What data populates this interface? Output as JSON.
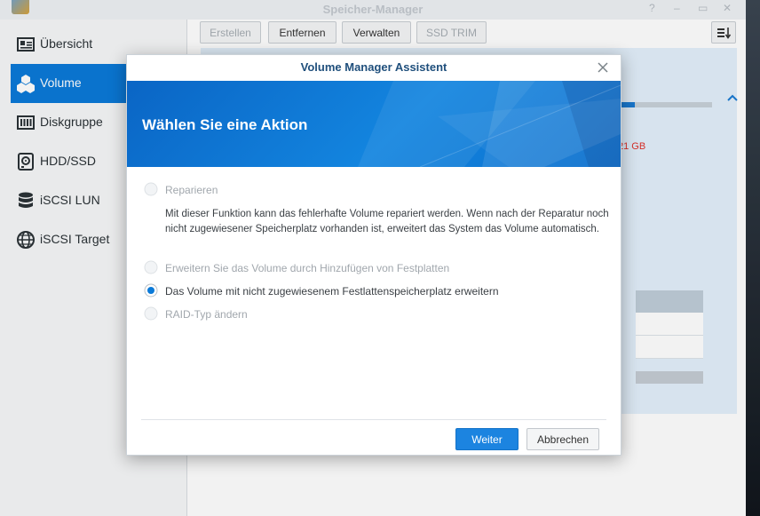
{
  "window": {
    "title": "Speicher-Manager",
    "controls": [
      "?",
      "–",
      "▭",
      "✕"
    ]
  },
  "sidebar": {
    "items": [
      {
        "label": "Übersicht",
        "icon": "overview-icon",
        "active": false
      },
      {
        "label": "Volume",
        "icon": "cubes-icon",
        "active": true
      },
      {
        "label": "Diskgruppe",
        "icon": "disk-group-icon",
        "active": false
      },
      {
        "label": "HDD/SSD",
        "icon": "hdd-icon",
        "active": false
      },
      {
        "label": "iSCSI LUN",
        "icon": "database-icon",
        "active": false
      },
      {
        "label": "iSCSI Target",
        "icon": "globe-icon",
        "active": false
      }
    ]
  },
  "toolbar": {
    "buttons": [
      {
        "label": "Erstellen",
        "enabled": false
      },
      {
        "label": "Entfernen",
        "enabled": true
      },
      {
        "label": "Verwalten",
        "enabled": true
      },
      {
        "label": "SSD TRIM",
        "enabled": false
      }
    ],
    "sort_icon": "sort-icon"
  },
  "volume_panel": {
    "size_fragment": "21 GB",
    "usage_fraction": 0.18
  },
  "dialog": {
    "title": "Volume Manager Assistent",
    "banner_title": "Wählen Sie eine Aktion",
    "options": [
      {
        "label": "Reparieren",
        "selected": false,
        "enabled": false
      },
      {
        "label": "Erweitern Sie das Volume durch Hinzufügen von Festplatten",
        "selected": false,
        "enabled": false
      },
      {
        "label": "Das Volume mit nicht zugewiesenem Festlattenspeicherplatz erweitern",
        "selected": true,
        "enabled": true
      },
      {
        "label": "RAID-Typ ändern",
        "selected": false,
        "enabled": false
      }
    ],
    "description": "Mit dieser Funktion kann das fehlerhafte Volume repariert werden. Wenn nach der Reparatur noch nicht zugewiesener Speicherplatz vorhanden ist, erweitert das System das Volume automatisch.",
    "buttons": {
      "next": "Weiter",
      "cancel": "Abbrechen"
    }
  },
  "colors": {
    "accent": "#0b7ad8",
    "banner": "#1385df",
    "warning": "#e0312a"
  }
}
